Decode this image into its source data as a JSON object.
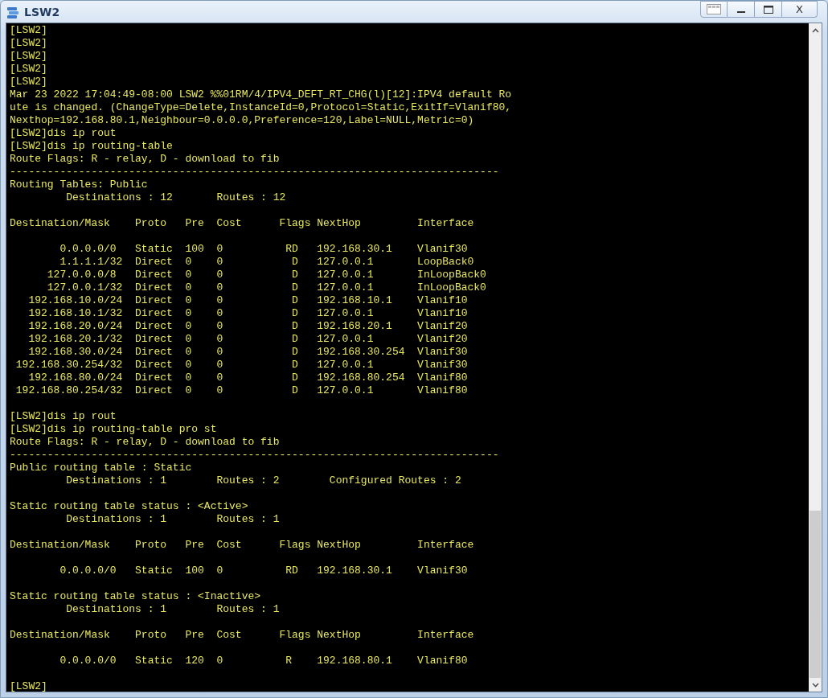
{
  "window": {
    "title": "LSW2",
    "close_label": "X"
  },
  "terminal": {
    "lines": [
      {
        "kind": "text",
        "text": "[LSW2]"
      },
      {
        "kind": "text",
        "text": "[LSW2]"
      },
      {
        "kind": "text",
        "text": "[LSW2]"
      },
      {
        "kind": "text",
        "text": "[LSW2]"
      },
      {
        "kind": "text",
        "text": "[LSW2]"
      },
      {
        "kind": "text",
        "text": "Mar 23 2022 17:04:49-08:00 LSW2 %%01RM/4/IPV4_DEFT_RT_CHG(l)[12]:IPV4 default Ro"
      },
      {
        "kind": "text",
        "text": "ute is changed. (ChangeType=Delete,InstanceId=0,Protocol=Static,ExitIf=Vlanif80,"
      },
      {
        "kind": "text",
        "text": "Nexthop=192.168.80.1,Neighbour=0.0.0.0,Preference=120,Label=NULL,Metric=0)"
      },
      {
        "kind": "text",
        "text": "[LSW2]dis ip rout"
      },
      {
        "kind": "text",
        "text": "[LSW2]dis ip routing-table"
      },
      {
        "kind": "text",
        "text": "Route Flags: R - relay, D - download to fib"
      },
      {
        "kind": "text",
        "text": "------------------------------------------------------------------------------"
      },
      {
        "kind": "text",
        "text": "Routing Tables: Public"
      },
      {
        "kind": "text",
        "text": "         Destinations : 12       Routes : 12"
      },
      {
        "kind": "blank"
      },
      {
        "kind": "text",
        "text": "Destination/Mask    Proto   Pre  Cost      Flags NextHop         Interface"
      },
      {
        "kind": "blank"
      },
      {
        "kind": "text",
        "text": "        0.0.0.0/0   Static  100  0          RD   192.168.30.1    Vlanif30"
      },
      {
        "kind": "text",
        "text": "        1.1.1.1/32  Direct  0    0           D   127.0.0.1       LoopBack0"
      },
      {
        "kind": "text",
        "text": "      127.0.0.0/8   Direct  0    0           D   127.0.0.1       InLoopBack0"
      },
      {
        "kind": "text",
        "text": "      127.0.0.1/32  Direct  0    0           D   127.0.0.1       InLoopBack0"
      },
      {
        "kind": "text",
        "text": "   192.168.10.0/24  Direct  0    0           D   192.168.10.1    Vlanif10"
      },
      {
        "kind": "text",
        "text": "   192.168.10.1/32  Direct  0    0           D   127.0.0.1       Vlanif10"
      },
      {
        "kind": "text",
        "text": "   192.168.20.0/24  Direct  0    0           D   192.168.20.1    Vlanif20"
      },
      {
        "kind": "text",
        "text": "   192.168.20.1/32  Direct  0    0           D   127.0.0.1       Vlanif20"
      },
      {
        "kind": "text",
        "text": "   192.168.30.0/24  Direct  0    0           D   192.168.30.254  Vlanif30"
      },
      {
        "kind": "text",
        "text": " 192.168.30.254/32  Direct  0    0           D   127.0.0.1       Vlanif30"
      },
      {
        "kind": "text",
        "text": "   192.168.80.0/24  Direct  0    0           D   192.168.80.254  Vlanif80"
      },
      {
        "kind": "text",
        "text": " 192.168.80.254/32  Direct  0    0           D   127.0.0.1       Vlanif80"
      },
      {
        "kind": "blank"
      },
      {
        "kind": "text",
        "text": "[LSW2]dis ip rout"
      },
      {
        "kind": "text",
        "text": "[LSW2]dis ip routing-table pro st"
      },
      {
        "kind": "text",
        "text": "Route Flags: R - relay, D - download to fib"
      },
      {
        "kind": "text",
        "text": "------------------------------------------------------------------------------"
      },
      {
        "kind": "text",
        "text": "Public routing table : Static"
      },
      {
        "kind": "text",
        "text": "         Destinations : 1        Routes : 2        Configured Routes : 2"
      },
      {
        "kind": "blank"
      },
      {
        "kind": "text",
        "text": "Static routing table status : <Active>"
      },
      {
        "kind": "text",
        "text": "         Destinations : 1        Routes : 1"
      },
      {
        "kind": "blank"
      },
      {
        "kind": "text",
        "text": "Destination/Mask    Proto   Pre  Cost      Flags NextHop         Interface"
      },
      {
        "kind": "blank"
      },
      {
        "kind": "text",
        "text": "        0.0.0.0/0   Static  100  0          RD   192.168.30.1    Vlanif30"
      },
      {
        "kind": "blank"
      },
      {
        "kind": "text",
        "text": "Static routing table status : <Inactive>"
      },
      {
        "kind": "text",
        "text": "         Destinations : 1        Routes : 1"
      },
      {
        "kind": "blank"
      },
      {
        "kind": "text",
        "text": "Destination/Mask    Proto   Pre  Cost      Flags NextHop         Interface"
      },
      {
        "kind": "blank"
      },
      {
        "kind": "text",
        "text": "        0.0.0.0/0   Static  120  0          R    192.168.80.1    Vlanif80"
      },
      {
        "kind": "blank"
      },
      {
        "kind": "text",
        "text": "[LSW2]"
      }
    ]
  }
}
